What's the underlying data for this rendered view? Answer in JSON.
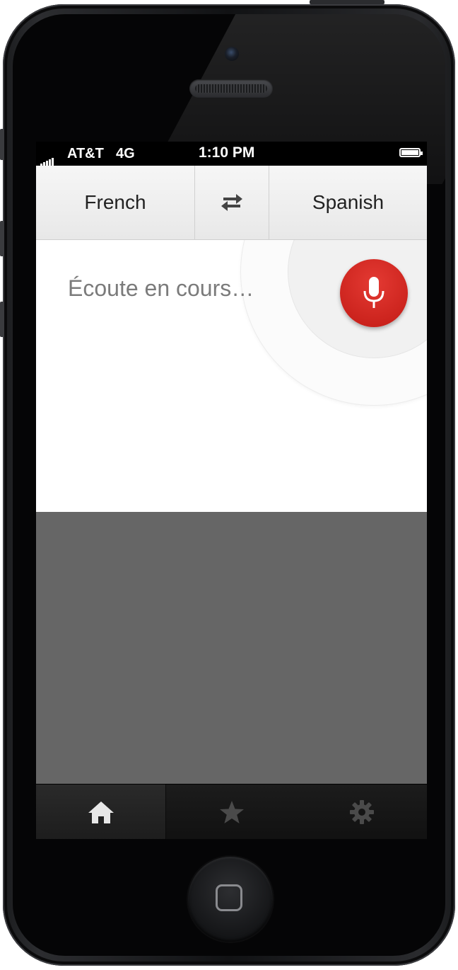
{
  "status_bar": {
    "carrier": "AT&T",
    "network": "4G",
    "time": "1:10 PM"
  },
  "language_bar": {
    "source_language": "French",
    "target_language": "Spanish",
    "swap_icon": "swap-arrows-icon"
  },
  "voice_input": {
    "status_text": "Écoute en cours…",
    "mic_icon": "microphone-icon",
    "mic_color": "#d42a24"
  },
  "tab_bar": {
    "tabs": [
      {
        "name": "home",
        "icon": "home-icon",
        "active": true
      },
      {
        "name": "favorites",
        "icon": "star-icon",
        "active": false
      },
      {
        "name": "settings",
        "icon": "gear-icon",
        "active": false
      }
    ]
  }
}
